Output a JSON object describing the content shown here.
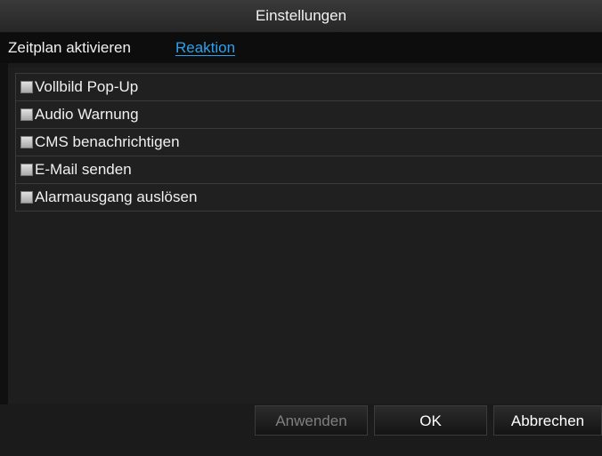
{
  "dialog": {
    "title": "Einstellungen"
  },
  "tabs": [
    {
      "label": "Zeitplan aktivieren",
      "active": false
    },
    {
      "label": "Reaktion",
      "active": true
    }
  ],
  "actions": [
    {
      "label": "Vollbild Pop-Up",
      "checked": false
    },
    {
      "label": "Audio Warnung",
      "checked": false
    },
    {
      "label": "CMS benachrichtigen",
      "checked": false
    },
    {
      "label": "E-Mail senden",
      "checked": false
    },
    {
      "label": "Alarmausgang auslösen",
      "checked": false
    }
  ],
  "buttons": {
    "apply": {
      "label": "Anwenden",
      "enabled": false
    },
    "ok": {
      "label": "OK",
      "enabled": true
    },
    "cancel": {
      "label": "Abbrechen",
      "enabled": true
    }
  },
  "colors": {
    "active_tab": "#2ea0ec",
    "disabled_text": "#7f7f7f"
  }
}
